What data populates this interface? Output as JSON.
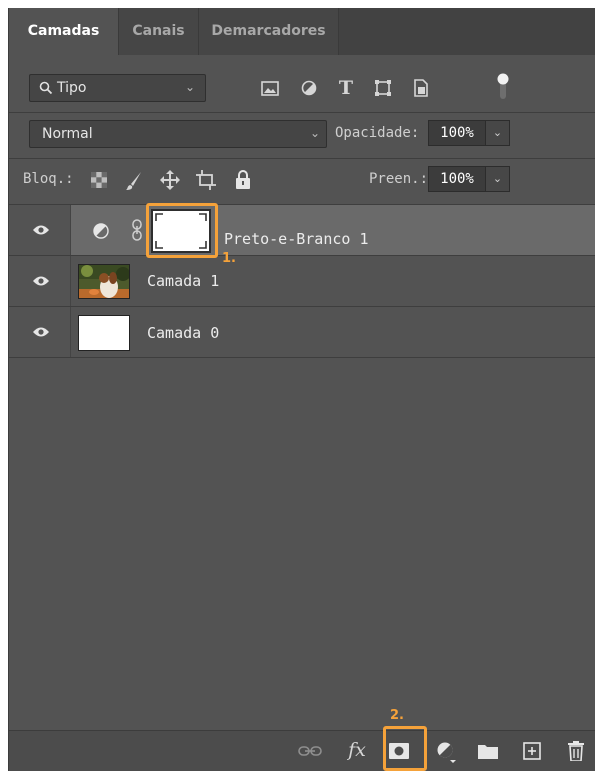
{
  "tabs": [
    {
      "label": "Camadas",
      "active": true
    },
    {
      "label": "Canais",
      "active": false
    },
    {
      "label": "Demarcadores",
      "active": false
    }
  ],
  "filter": {
    "kind_label": "Tipo",
    "icons": [
      "image-filter-icon",
      "adjustment-filter-icon",
      "type-filter-icon",
      "shape-filter-icon",
      "smart-object-filter-icon",
      "filter-toggle-icon"
    ]
  },
  "blend": {
    "mode": "Normal",
    "opacity_label": "Opacidade:",
    "opacity_value": "100%"
  },
  "lock": {
    "label": "Bloq.:",
    "icons": [
      "lock-transparent-icon",
      "lock-pixels-icon",
      "lock-position-icon",
      "lock-artboard-icon",
      "lock-all-icon"
    ],
    "fill_label": "Preen.:",
    "fill_value": "100%"
  },
  "layers": [
    {
      "name": "Preto-e-Branco 1",
      "type": "adjustment",
      "visible": true,
      "selected": true
    },
    {
      "name": "Camada 1",
      "type": "photo",
      "visible": true,
      "selected": false
    },
    {
      "name": "Camada 0",
      "type": "white",
      "visible": true,
      "selected": false
    }
  ],
  "callouts": {
    "one": "1.",
    "two": "2."
  },
  "bottom_icons": [
    "link-layers-icon",
    "fx-icon",
    "add-mask-icon",
    "new-adjustment-icon",
    "new-group-icon",
    "new-layer-icon",
    "delete-icon"
  ],
  "fx_label": "fx",
  "colors": {
    "panel": "#535353",
    "selected_row": "#6a6a6a",
    "callout": "#f5a23a"
  }
}
